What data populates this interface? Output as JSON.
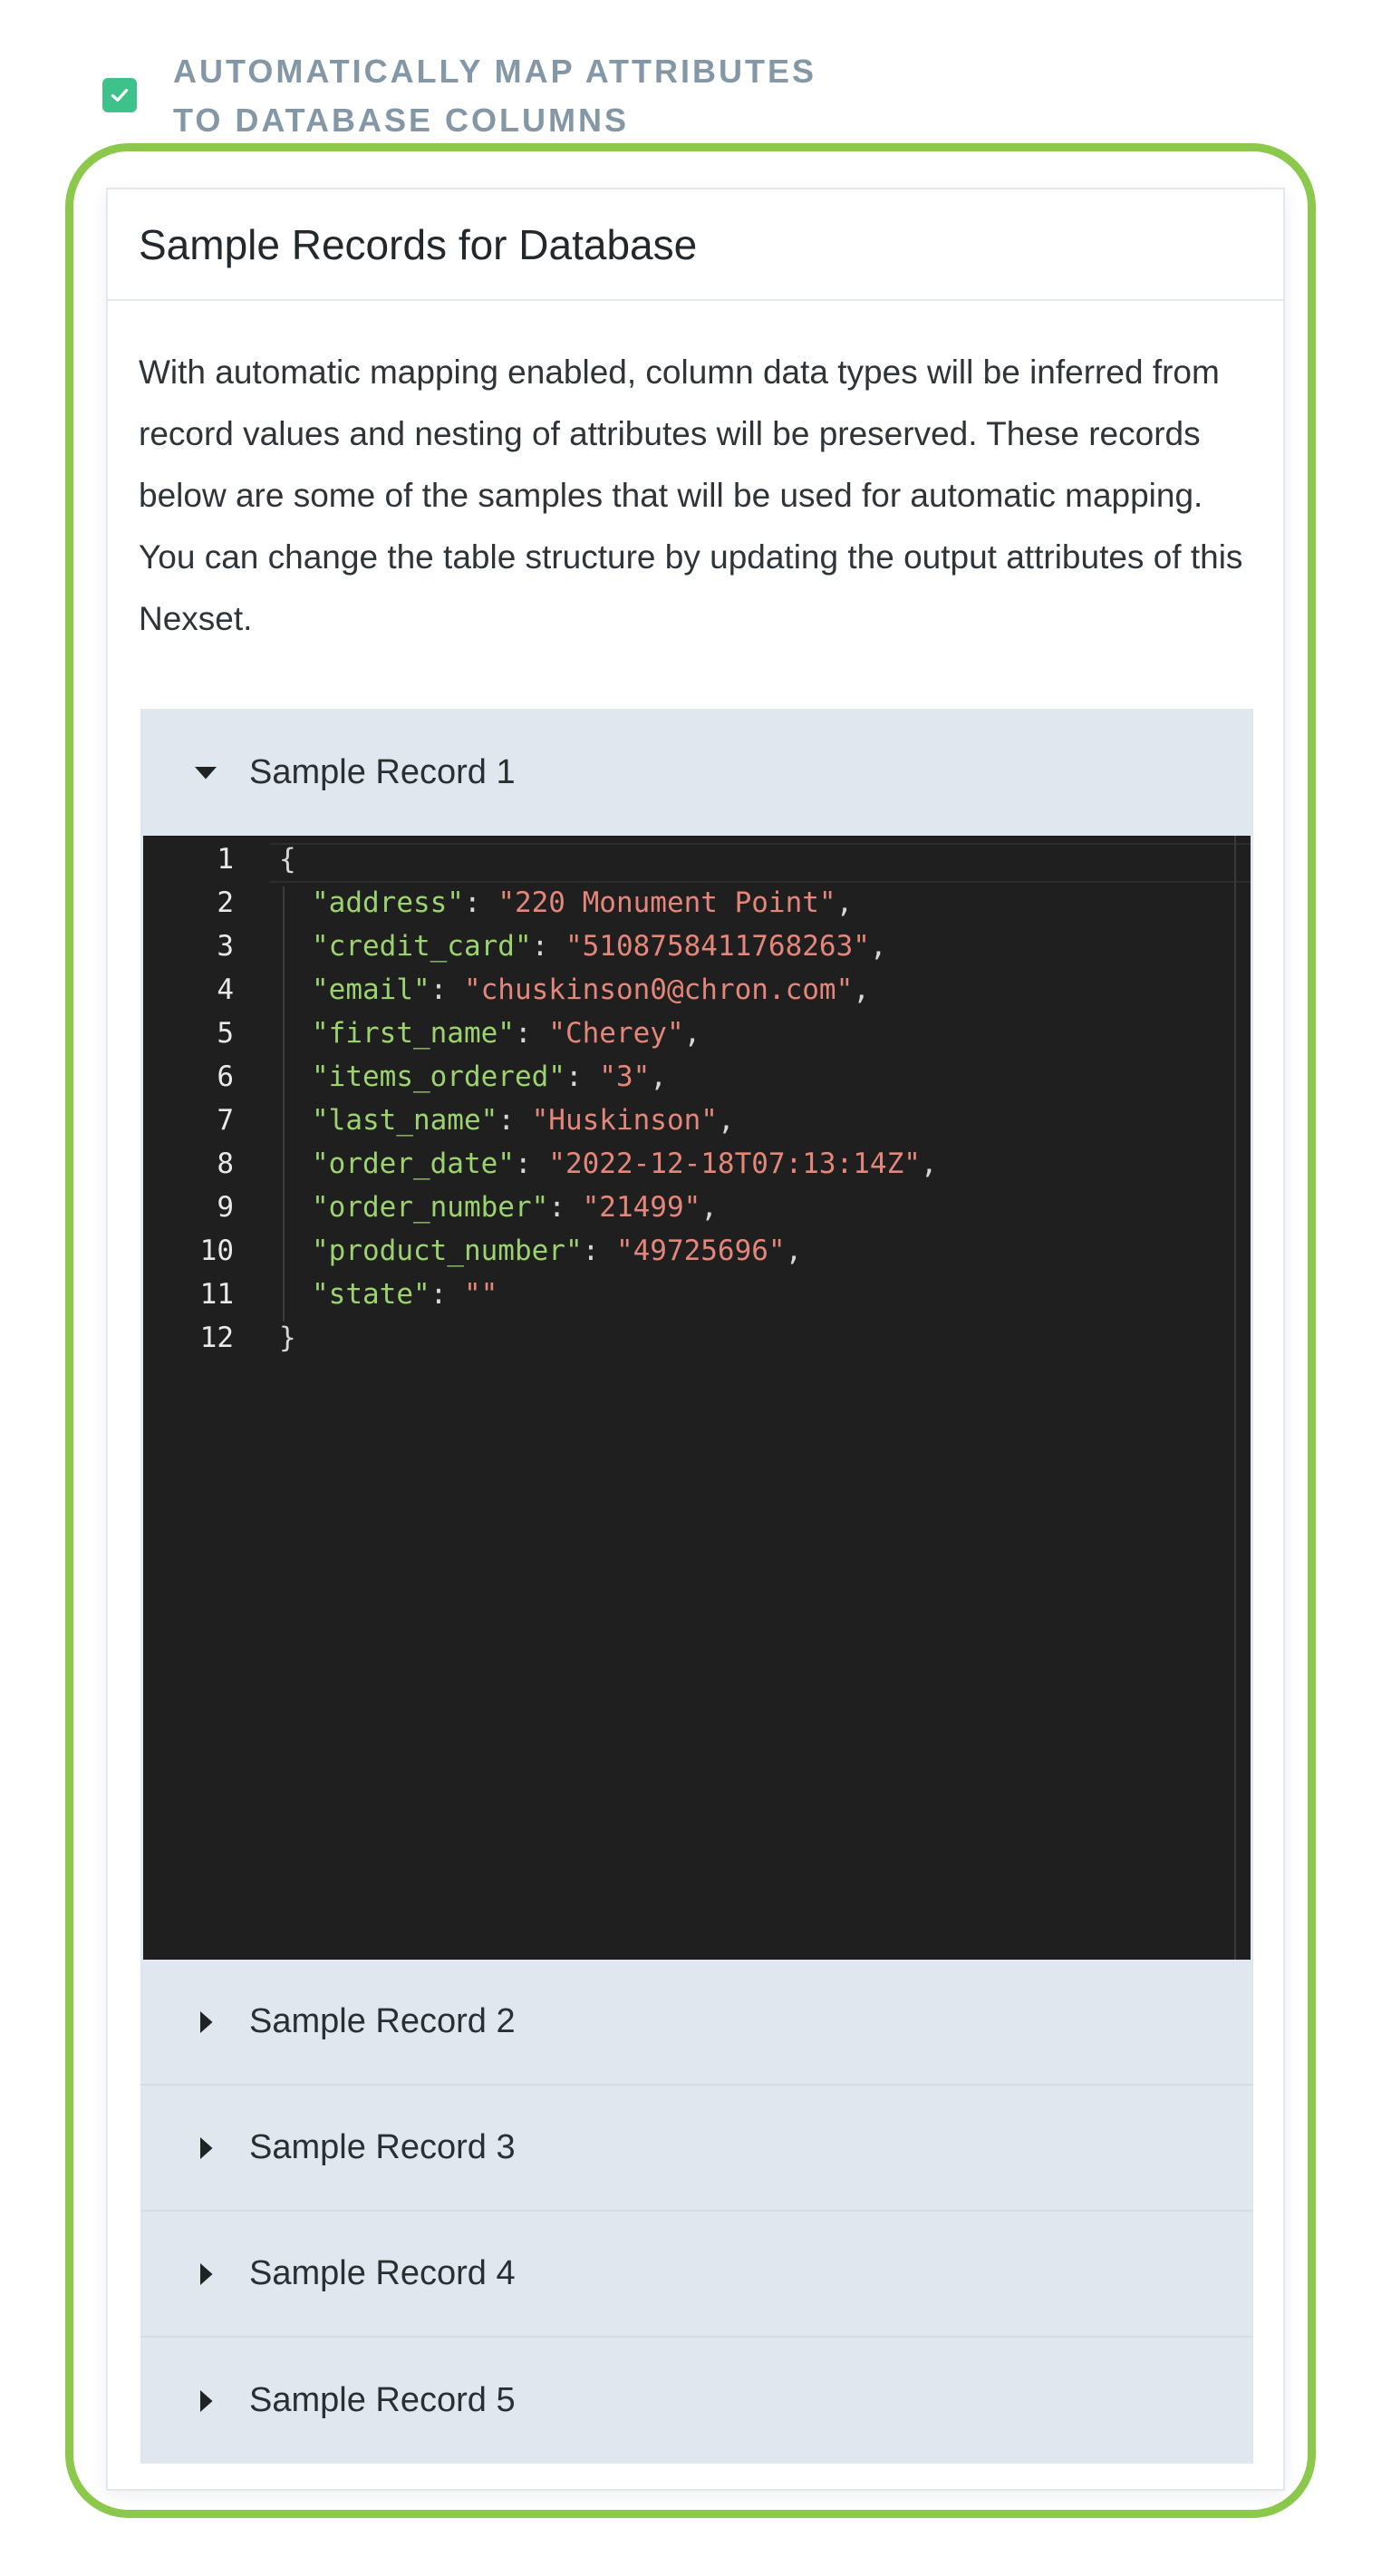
{
  "auto_map": {
    "checked": true,
    "label": "Automatically map attributes\nto database columns"
  },
  "card": {
    "title": "Sample Records for Database",
    "description": "With automatic mapping enabled, column data types will be inferred from record values and nesting of attributes will be preserved. These records below are some of the samples that will be used for automatic mapping. You can change the table structure by updating the output attributes of this Nexset."
  },
  "records": [
    {
      "label": "Sample Record 1",
      "expanded": true
    },
    {
      "label": "Sample Record 2",
      "expanded": false
    },
    {
      "label": "Sample Record 3",
      "expanded": false
    },
    {
      "label": "Sample Record 4",
      "expanded": false
    },
    {
      "label": "Sample Record 5",
      "expanded": false
    }
  ],
  "code": {
    "line_numbers": [
      "1",
      "2",
      "3",
      "4",
      "5",
      "6",
      "7",
      "8",
      "9",
      "10",
      "11",
      "12"
    ],
    "open_brace": "{",
    "close_brace": "}",
    "fields": [
      {
        "key": "\"address\"",
        "value": "\"220 Monument Point\"",
        "sep": ","
      },
      {
        "key": "\"credit_card\"",
        "value": "\"5108758411768263\"",
        "sep": ","
      },
      {
        "key": "\"email\"",
        "value": "\"chuskinson0@chron.com\"",
        "sep": ","
      },
      {
        "key": "\"first_name\"",
        "value": "\"Cherey\"",
        "sep": ","
      },
      {
        "key": "\"items_ordered\"",
        "value": "\"3\"",
        "sep": ","
      },
      {
        "key": "\"last_name\"",
        "value": "\"Huskinson\"",
        "sep": ","
      },
      {
        "key": "\"order_date\"",
        "value": "\"2022-12-18T07:13:14Z\"",
        "sep": ","
      },
      {
        "key": "\"order_number\"",
        "value": "\"21499\"",
        "sep": ","
      },
      {
        "key": "\"product_number\"",
        "value": "\"49725696\"",
        "sep": ","
      },
      {
        "key": "\"state\"",
        "value": "\"\"",
        "sep": ""
      }
    ]
  },
  "colors": {
    "accent_green": "#8cc84b",
    "checkbox_green": "#3ec28b",
    "accordion_bg": "#e0e7ef",
    "code_bg": "#1f1f1f",
    "code_key": "#9bd36f",
    "code_string": "#e4867a"
  },
  "icons": {
    "checkbox": "check-icon",
    "expanded": "caret-down-icon",
    "collapsed": "caret-right-icon"
  }
}
